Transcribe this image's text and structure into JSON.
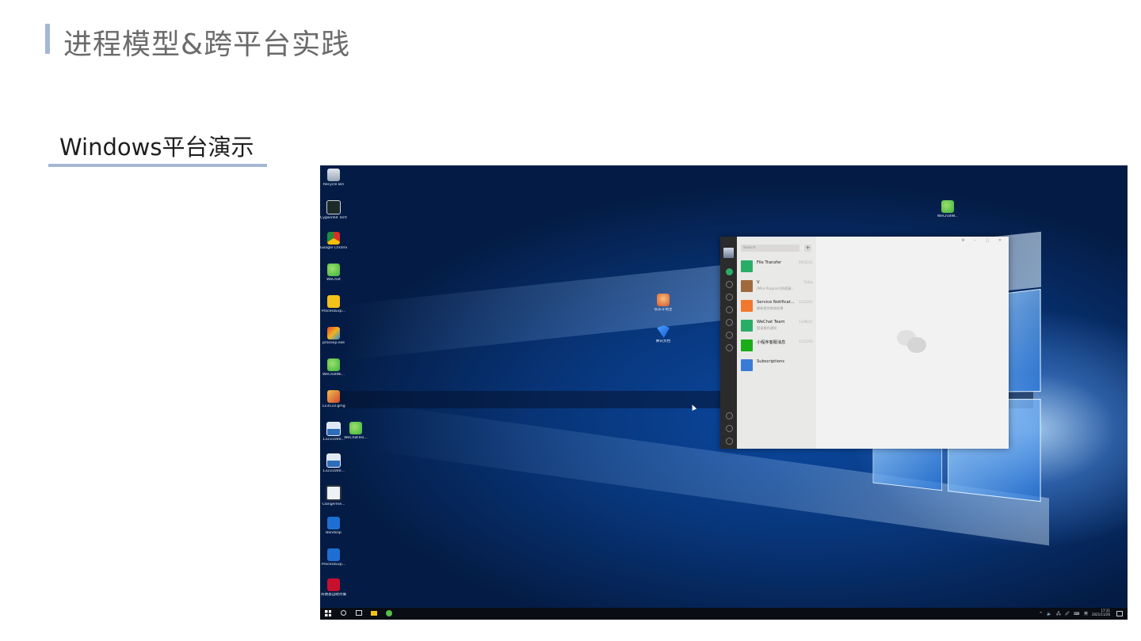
{
  "slide": {
    "title": "进程模型&跨平台实践",
    "section_title": "Windows平台演示"
  },
  "desktop": {
    "left_icons": [
      {
        "label": "Recycle Bin",
        "icon": "recycle-bin-icon"
      },
      {
        "label": "Cygwin64 Terminal",
        "icon": "terminal-icon"
      },
      {
        "label": "Google Chrome",
        "icon": "chrome-icon"
      },
      {
        "label": "WeChat",
        "icon": "wechat-icon"
      },
      {
        "label": "ProcessExp...",
        "icon": "folder-icon"
      },
      {
        "label": "procexp.exe",
        "icon": "exe-icon"
      },
      {
        "label": "WeChatWi...",
        "icon": "wechat-icon"
      },
      {
        "label": "123133.gmg",
        "icon": "image-icon"
      },
      {
        "label": "13231000...",
        "icon": "picture-icon"
      },
      {
        "label": "13231000...",
        "icon": "picture-icon"
      },
      {
        "label": "ClangFrme...",
        "icon": "clang-icon"
      },
      {
        "label": "Bandizip",
        "icon": "bandizip-icon"
      },
      {
        "label": "ProcessExp...",
        "icon": "bandizip-icon"
      },
      {
        "label": "肯德基自助点餐",
        "icon": "kfc-icon"
      }
    ],
    "extra_icons": [
      {
        "label": "WeChatTes...",
        "icon": "wechat-icon"
      },
      {
        "label": "欢乐斗地主",
        "icon": "game-avatar-icon"
      },
      {
        "label": "腾讯文档",
        "icon": "tencent-docs-icon"
      },
      {
        "label": "WeChatW...",
        "icon": "wechat-icon"
      }
    ]
  },
  "wechat": {
    "search_placeholder": "Search",
    "add_label": "+",
    "window_controls": "⚙ – ▢ ✕",
    "chats": [
      {
        "name": "File Transfer",
        "preview": "",
        "date": "09/22/21",
        "color": "#2aae67"
      },
      {
        "name": "V",
        "preview": "[Mini Program]肯德基...",
        "date": "Today",
        "color": "#a06a3c"
      },
      {
        "name": "Service Notificat...",
        "preview": "最新提交审核结果",
        "date": "11/15/21",
        "color": "#f27830"
      },
      {
        "name": "WeChat Team",
        "preview": "登录操作通知",
        "date": "11/06/21",
        "color": "#2aae67"
      },
      {
        "name": "小程序客服消息",
        "preview": "",
        "date": "11/12/21",
        "color": "#1aad19"
      },
      {
        "name": "Subscriptions",
        "preview": "",
        "date": "",
        "color": "#3a7bd5"
      }
    ]
  },
  "taskbar": {
    "time": "17:31",
    "date": "2021/11/26",
    "tray": "^ 🔈 🖧 🖉 ⌨ 英"
  }
}
